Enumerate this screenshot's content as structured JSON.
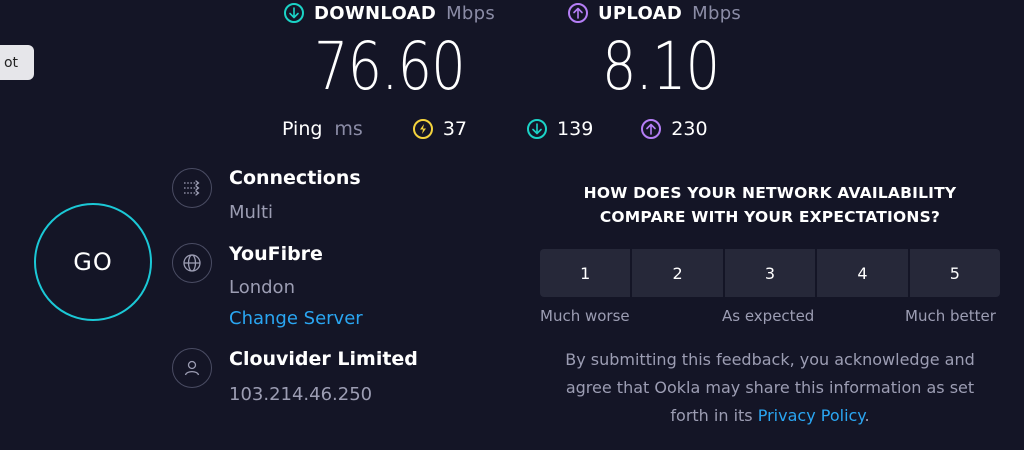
{
  "side_tab": {
    "label": "ot"
  },
  "download": {
    "label": "DOWNLOAD",
    "unit": "Mbps",
    "value": "76.60",
    "color": "#1bd3c6"
  },
  "upload": {
    "label": "UPLOAD",
    "unit": "Mbps",
    "value": "8.10",
    "color": "#b57ef6"
  },
  "ping": {
    "label": "Ping",
    "unit": "ms",
    "idle": {
      "value": "37",
      "icon": "bolt-icon",
      "color": "#f4d33d"
    },
    "download": {
      "value": "139",
      "icon": "download-arrow-icon",
      "color": "#1bd3c6"
    },
    "upload": {
      "value": "230",
      "icon": "upload-arrow-icon",
      "color": "#b57ef6"
    }
  },
  "go_button": {
    "label": "GO",
    "color": "#1bc8d6"
  },
  "connections": {
    "title": "Connections",
    "value": "Multi",
    "icon": "connections-icon"
  },
  "isp": {
    "title": "YouFibre",
    "location": "London",
    "change_server": "Change Server",
    "icon": "globe-icon"
  },
  "server": {
    "title": "Clouvider Limited",
    "ip": "103.214.46.250",
    "icon": "user-icon"
  },
  "survey": {
    "question_line1": "HOW DOES YOUR NETWORK AVAILABILITY",
    "question_line2": "COMPARE WITH YOUR EXPECTATIONS?",
    "options": [
      "1",
      "2",
      "3",
      "4",
      "5"
    ],
    "low_label": "Much worse",
    "mid_label": "As expected",
    "high_label": "Much better"
  },
  "disclaimer": {
    "text_line1": "By submitting this feedback, you acknowledge and",
    "text_line2": "agree that Ookla may share this information as set",
    "text_line3_prefix": "forth in its",
    "link": "Privacy Policy",
    "suffix": "."
  },
  "colors": {
    "background": "#141526",
    "link": "#2aa6f2",
    "muted": "#9c9db3"
  }
}
